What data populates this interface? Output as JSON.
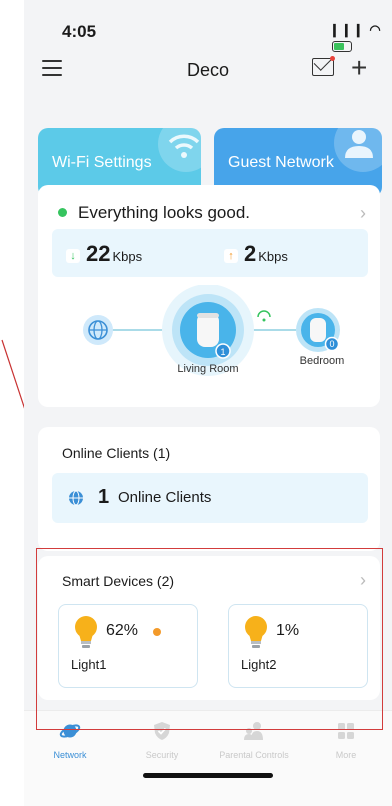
{
  "status_bar": {
    "time": "4:05",
    "signal": "❙❙❙",
    "wifi": "◗"
  },
  "nav": {
    "title": "Deco"
  },
  "tiles": {
    "wifi_label": "Wi-Fi Settings",
    "guest_label": "Guest Network"
  },
  "network_status": {
    "text": "Everything looks good.",
    "download_value": "22",
    "download_unit": "Kbps",
    "upload_value": "2",
    "upload_unit": "Kbps",
    "main_node_label": "Living Room",
    "main_node_count": "1",
    "satellite_label": "Bedroom",
    "satellite_count": "0"
  },
  "clients": {
    "title": "Online Clients (1)",
    "count": "1",
    "label": "Online Clients"
  },
  "smart_devices": {
    "title": "Smart Devices (2)",
    "devices": [
      {
        "name": "Light1",
        "brightness": "62%",
        "on": true
      },
      {
        "name": "Light2",
        "brightness": "1%",
        "on": false
      }
    ]
  },
  "tabbar": {
    "tabs": [
      {
        "label": "Network"
      },
      {
        "label": "Security"
      },
      {
        "label": "Parental Controls"
      },
      {
        "label": "More"
      }
    ]
  },
  "colors": {
    "accent": "#3b8fd6",
    "online": "#36c45f",
    "highlight": "#d23c3c",
    "wifi_tile": "#5ccae8",
    "guest_tile": "#47a4ea"
  }
}
